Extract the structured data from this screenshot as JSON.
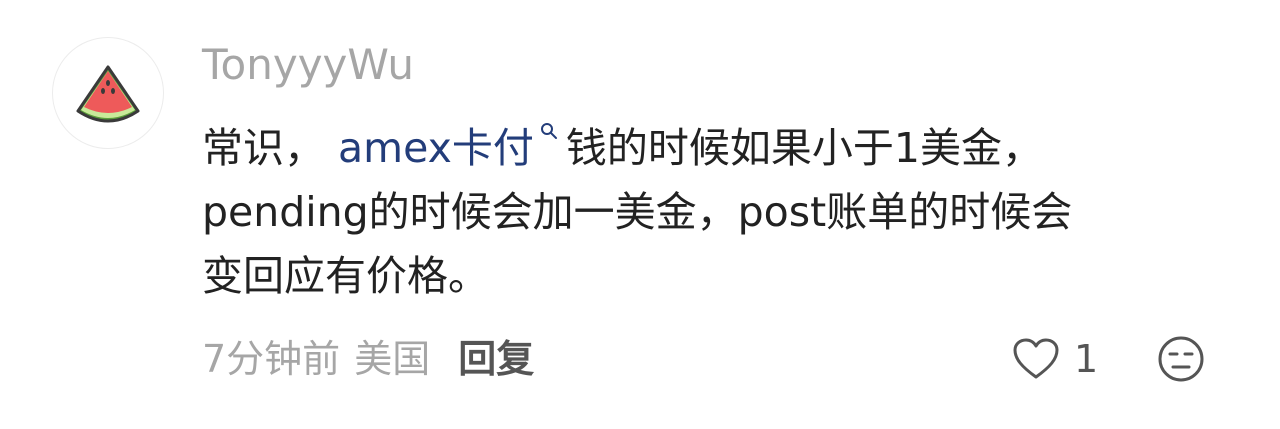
{
  "comment": {
    "username": "TonyyyWu",
    "content": {
      "line1_prefix": "常识， ",
      "link_text": "amex卡付",
      "line1_suffix": "钱的时候如果小于1美金，",
      "line2": "pending的时候会加一美金，post账单的时候会",
      "line3": "变回应有价格。"
    },
    "meta": {
      "time": "7分钟前",
      "location": "美国",
      "reply_label": "回复"
    },
    "like_count": "1",
    "icons": {
      "avatar": "watermelon-avatar-icon",
      "link_search": "search-icon",
      "like": "heart-icon",
      "dislike": "meh-face-icon"
    },
    "colors": {
      "link": "#233d7a",
      "meta": "#a6a6a6",
      "text": "#222222"
    }
  }
}
